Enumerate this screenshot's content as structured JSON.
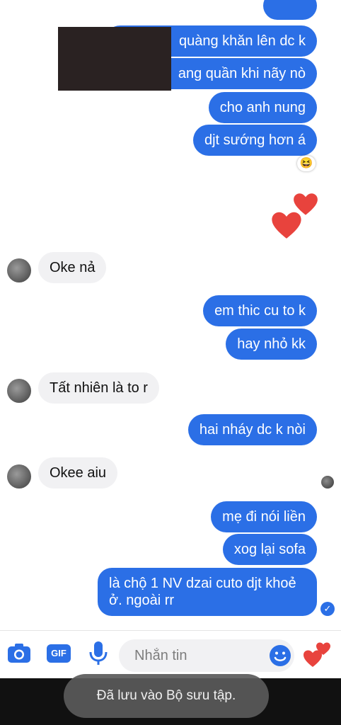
{
  "messages": {
    "out_1": "quàng khăn lên dc k",
    "out_2": "ang quần khi nãy nò",
    "out_3": "cho anh nung",
    "out_4": "djt sướng hơn á",
    "reaction": "😆",
    "in_1": "Oke nả",
    "out_5": "em thic cu to k",
    "out_6": "hay nhỏ kk",
    "in_2": "Tất nhiên là to r",
    "out_7": "hai nháy dc k nòi",
    "in_3": "Okee aiu",
    "out_8": "mẹ đi nói liền",
    "out_9": "xog lại sofa",
    "out_10": "là chộ 1 NV dzai cuto djt khoẻ ở. ngoài rr"
  },
  "composer": {
    "placeholder": "Nhắn tin",
    "gif_label": "GIF"
  },
  "toast": {
    "text": "Đã lưu vào Bộ sưu tập."
  },
  "colors": {
    "accent": "#2b6fe6",
    "incoming_bubble": "#f1f1f3",
    "heart": "#e8433d"
  },
  "icons": [
    "camera-icon",
    "gif-icon",
    "microphone-icon",
    "emoji-icon",
    "heart-icon",
    "check-icon"
  ]
}
